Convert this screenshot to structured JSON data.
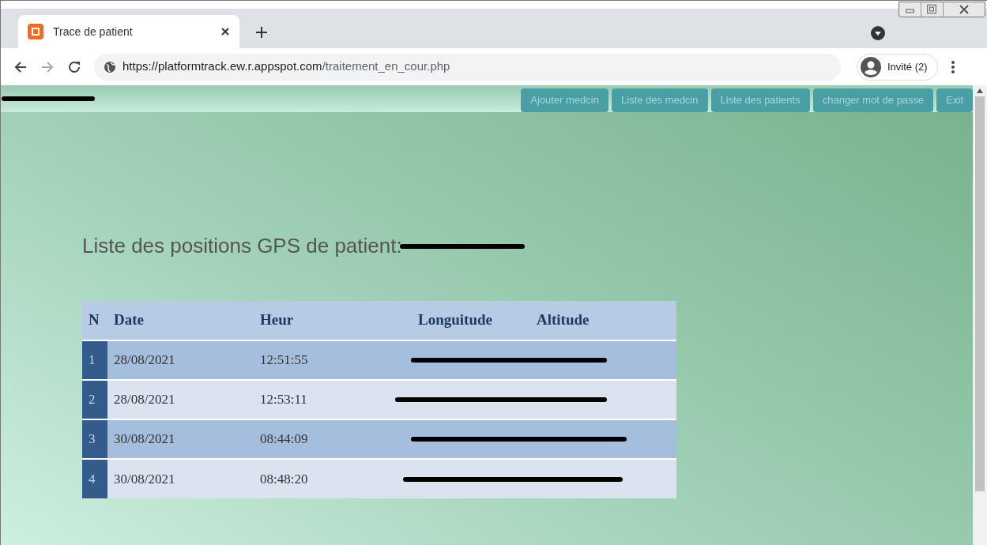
{
  "browser": {
    "tab_title": "Trace de patient",
    "url_host": "https://platformtrack.ew.r.appspot.com",
    "url_path": "/traitement_en_cour.php",
    "profile": "Invité (2)"
  },
  "nav": {
    "buttons": [
      "Ajouter medcin",
      "Liste des medcin",
      "Liste des patients",
      "changer mot de passe",
      "Exit"
    ]
  },
  "heading": "Liste des positions GPS de patient:",
  "table": {
    "columns": [
      "N",
      "Date",
      "Heur",
      "Longuitude",
      "Altitude"
    ],
    "rows": [
      {
        "n": "1",
        "date": "28/08/2021",
        "time": "12:51:55"
      },
      {
        "n": "2",
        "date": "28/08/2021",
        "time": "12:53:11"
      },
      {
        "n": "3",
        "date": "30/08/2021",
        "time": "08:44:09"
      },
      {
        "n": "4",
        "date": "30/08/2021",
        "time": "08:48:20"
      }
    ]
  }
}
